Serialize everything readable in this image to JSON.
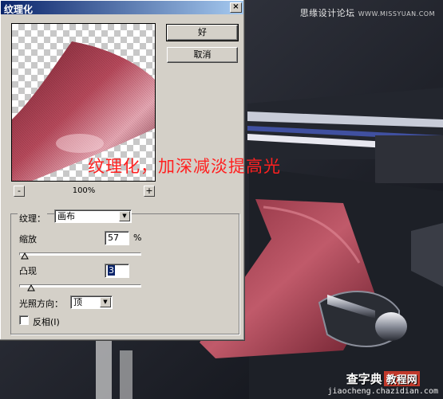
{
  "dialog": {
    "title": "纹理化",
    "close_glyph": "×",
    "ok_label": "好",
    "cancel_label": "取消",
    "zoom_out_glyph": "-",
    "zoom_in_glyph": "+",
    "zoom_level": "100%"
  },
  "controls": {
    "texture_label": "纹理：",
    "texture_value": "画布",
    "scale_label": "缩放",
    "scale_value": "57",
    "scale_unit": "%",
    "scale_fraction": 0.0,
    "relief_label": "凸现",
    "relief_value": "3",
    "relief_fraction": 0.06,
    "light_label": "光照方向：",
    "light_value": "顶",
    "invert_label": "反相(I)",
    "invert_checked": false
  },
  "overlay": {
    "caption": "纹理化，加深减淡提高光"
  },
  "watermarks": {
    "top": "思缘设计论坛",
    "top_url": "WWW.MISSYUAN.COM",
    "bottom_name": "查字典",
    "bottom_box": "教程网",
    "bottom_url": "jiaocheng.chazidian.com"
  },
  "colors": {
    "title_gradient_start": "#0a246a",
    "dialog_face": "#d4d0c8",
    "caption_red": "#ff2020",
    "leather": "#b0485a"
  }
}
